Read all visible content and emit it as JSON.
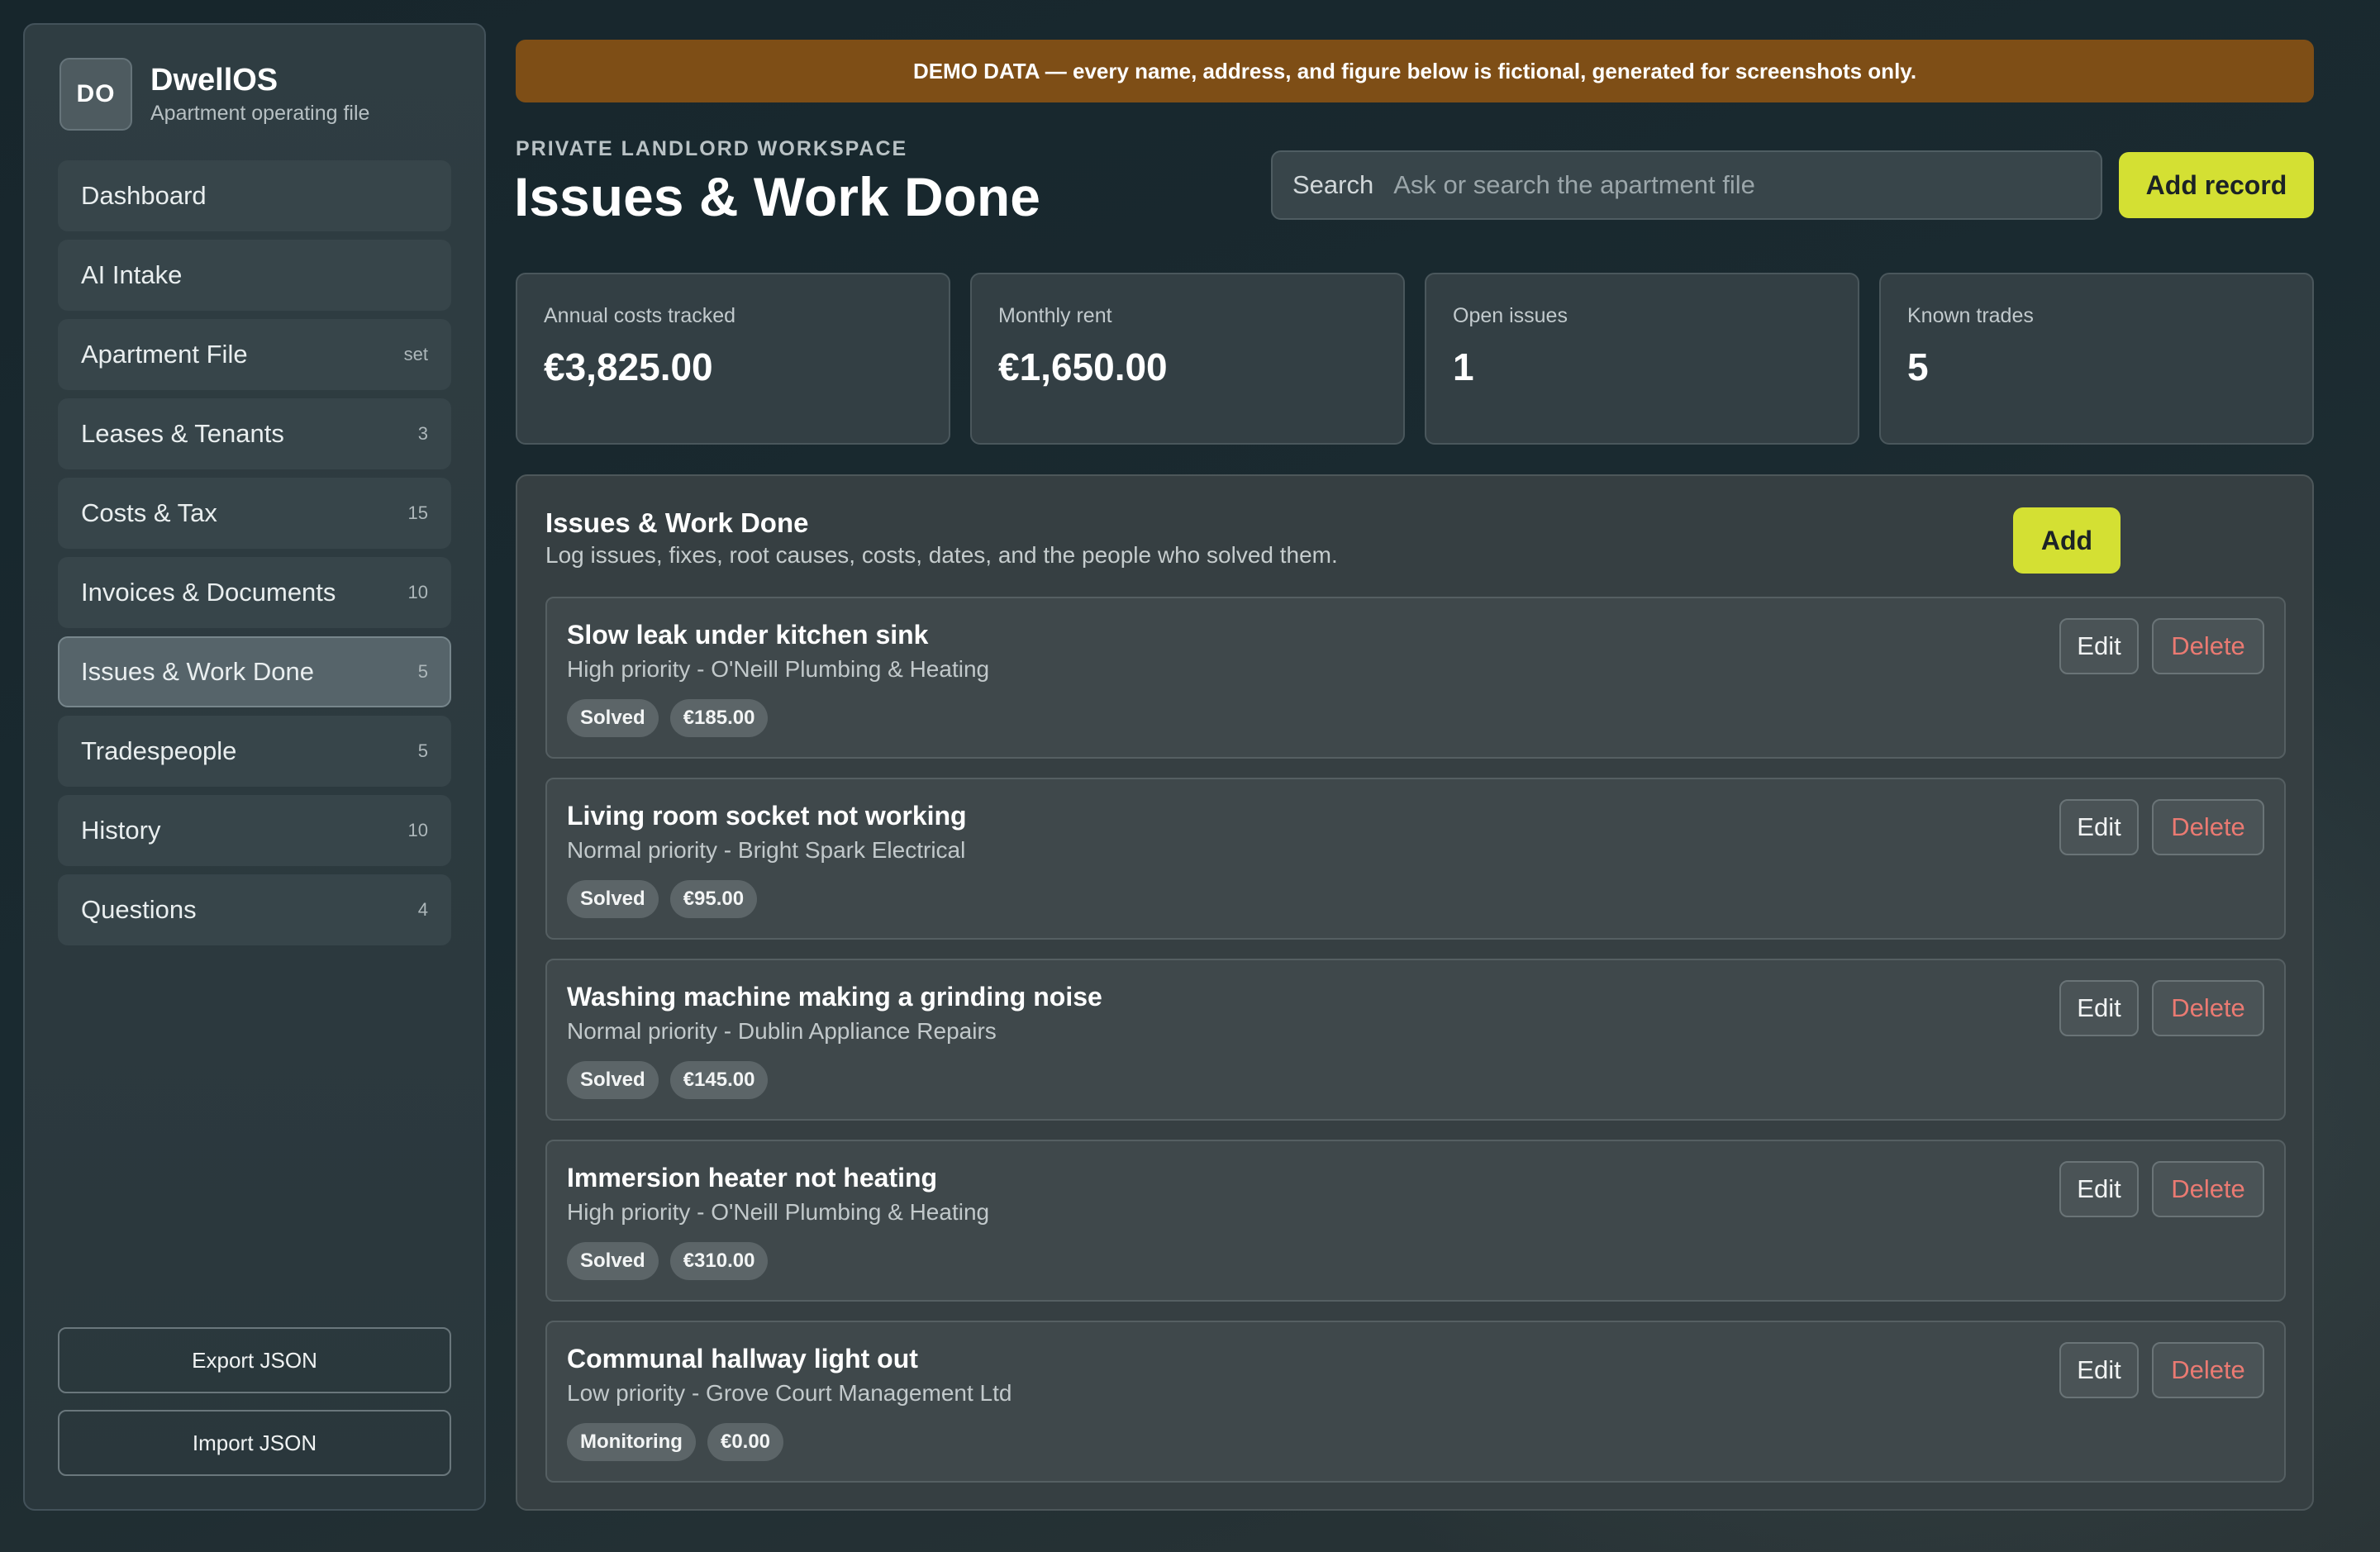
{
  "brand": {
    "mark": "DO",
    "name": "DwellOS",
    "subtitle": "Apartment operating file"
  },
  "nav": [
    {
      "label": "Dashboard",
      "count": ""
    },
    {
      "label": "AI Intake",
      "count": ""
    },
    {
      "label": "Apartment File",
      "count": "set"
    },
    {
      "label": "Leases & Tenants",
      "count": "3"
    },
    {
      "label": "Costs & Tax",
      "count": "15"
    },
    {
      "label": "Invoices & Documents",
      "count": "10"
    },
    {
      "label": "Issues & Work Done",
      "count": "5",
      "active": true
    },
    {
      "label": "Tradespeople",
      "count": "5"
    },
    {
      "label": "History",
      "count": "10"
    },
    {
      "label": "Questions",
      "count": "4"
    }
  ],
  "sidebar_actions": {
    "export": "Export JSON",
    "import": "Import JSON"
  },
  "banner": "DEMO DATA — every name, address, and figure below is fictional, generated for screenshots only.",
  "header": {
    "eyebrow": "PRIVATE LANDLORD WORKSPACE",
    "title": "Issues & Work Done",
    "search_label": "Search",
    "search_placeholder": "Ask or search the apartment file",
    "add_record": "Add record"
  },
  "stats": [
    {
      "label": "Annual costs tracked",
      "value": "€3,825.00"
    },
    {
      "label": "Monthly rent",
      "value": "€1,650.00"
    },
    {
      "label": "Open issues",
      "value": "1"
    },
    {
      "label": "Known trades",
      "value": "5"
    }
  ],
  "panel": {
    "title": "Issues & Work Done",
    "subtitle": "Log issues, fixes, root causes, costs, dates, and the people who solved them.",
    "add": "Add",
    "edit_label": "Edit",
    "delete_label": "Delete"
  },
  "issues": [
    {
      "title": "Slow leak under kitchen sink",
      "meta": "High priority - O'Neill Plumbing & Heating",
      "status": "Solved",
      "cost": "€185.00"
    },
    {
      "title": "Living room socket not working",
      "meta": "Normal priority - Bright Spark Electrical",
      "status": "Solved",
      "cost": "€95.00"
    },
    {
      "title": "Washing machine making a grinding noise",
      "meta": "Normal priority - Dublin Appliance Repairs",
      "status": "Solved",
      "cost": "€145.00"
    },
    {
      "title": "Immersion heater not heating",
      "meta": "High priority - O'Neill Plumbing & Heating",
      "status": "Solved",
      "cost": "€310.00"
    },
    {
      "title": "Communal hallway light out",
      "meta": "Low priority - Grove Court Management Ltd",
      "status": "Monitoring",
      "cost": "€0.00"
    }
  ]
}
